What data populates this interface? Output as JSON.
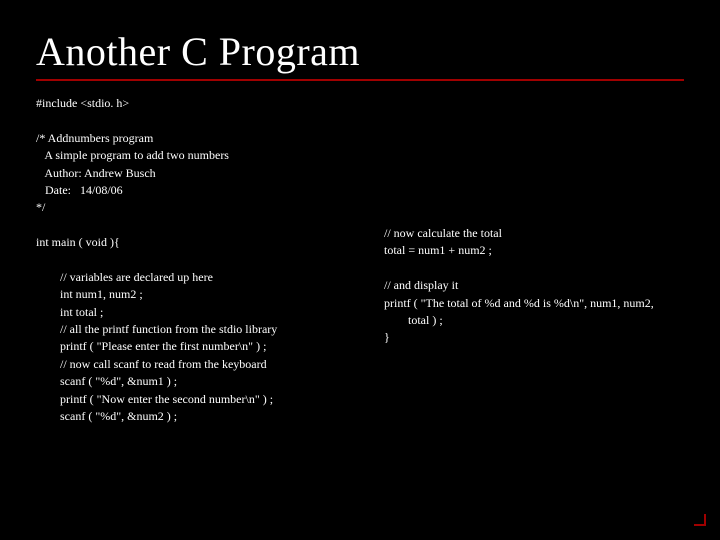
{
  "title": "Another C Program",
  "code_left": "#include <stdio. h>\n\n/* Addnumbers program\n   A simple program to add two numbers\n   Author: Andrew Busch\n   Date:   14/08/06\n*/\n\nint main ( void ){\n\n        // variables are declared up here\n        int num1, num2 ;\n        int total ;\n        // all the printf function from the stdio library\n        printf ( \"Please enter the first number\\n\" ) ;\n        // now call scanf to read from the keyboard\n        scanf ( \"%d\", &num1 ) ;\n        printf ( \"Now enter the second number\\n\" ) ;\n        scanf ( \"%d\", &num2 ) ;",
  "code_right": "// now calculate the total\ntotal = num1 + num2 ;\n\n// and display it\nprintf ( \"The total of %d and %d is %d\\n\", num1, num2,\n        total ) ;\n}"
}
